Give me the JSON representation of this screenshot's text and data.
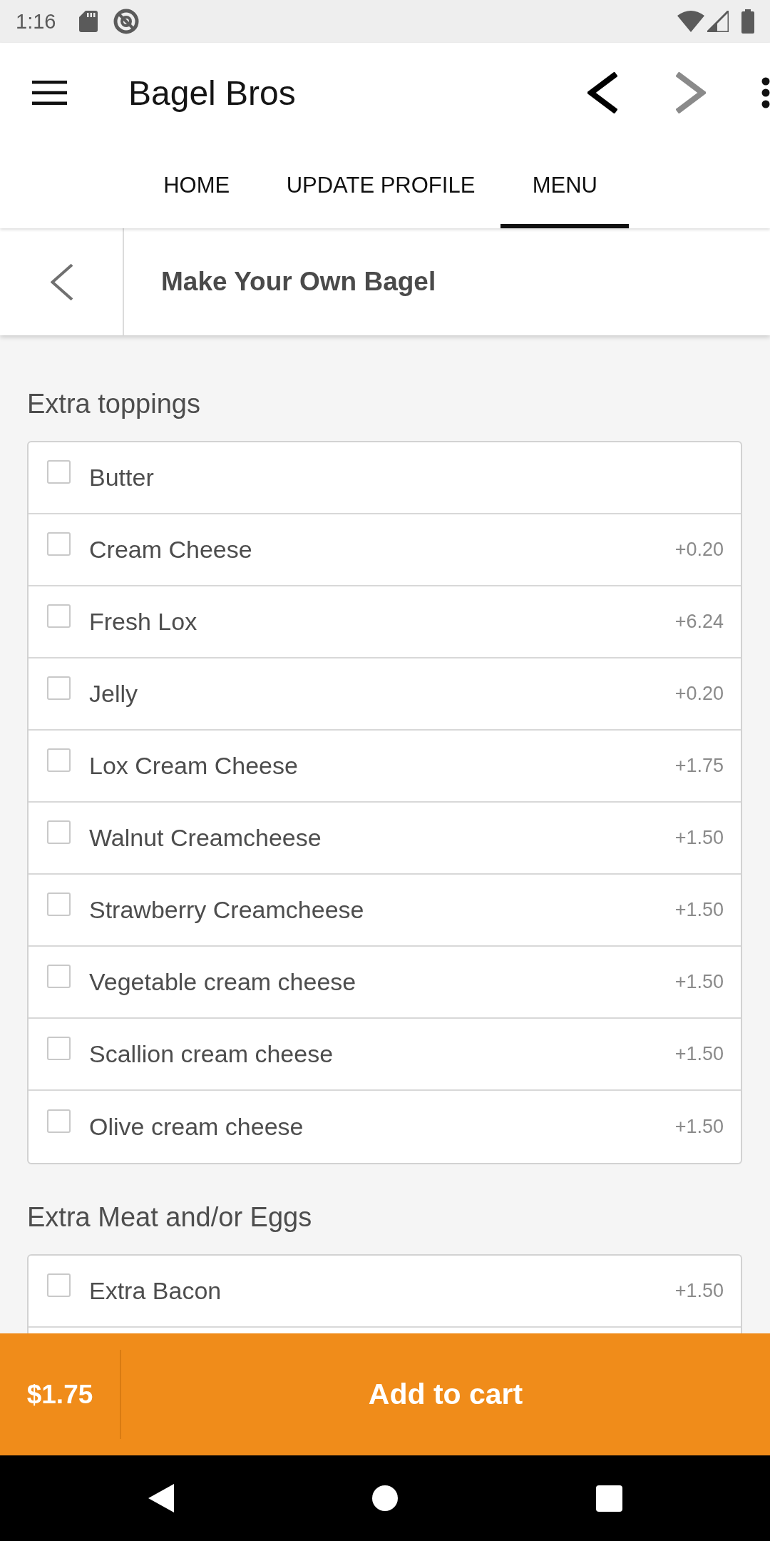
{
  "status_bar": {
    "time": "1:16"
  },
  "toolbar": {
    "title": "Bagel Bros",
    "nav_buttons": [
      {
        "kind": "back",
        "disabled": false
      },
      {
        "kind": "forward",
        "disabled": true
      }
    ]
  },
  "tabs": [
    {
      "label": "HOME",
      "selected": false
    },
    {
      "label": "UPDATE PROFILE",
      "selected": false
    },
    {
      "label": "MENU",
      "selected": true
    }
  ],
  "header": {
    "title": "Make Your Own Bagel"
  },
  "sections": [
    {
      "title": "Extra toppings",
      "options": [
        {
          "name": "Butter",
          "checked": false
        },
        {
          "name": "Cream Cheese",
          "price": "+0.20",
          "checked": false
        },
        {
          "name": "Fresh Lox",
          "price": "+6.24",
          "checked": false
        },
        {
          "name": "Jelly",
          "price": "+0.20",
          "checked": false
        },
        {
          "name": "Lox Cream Cheese",
          "price": "+1.75",
          "checked": false
        },
        {
          "name": "Walnut Creamcheese",
          "price": "+1.50",
          "checked": false
        },
        {
          "name": "Strawberry Creamcheese",
          "price": "+1.50",
          "checked": false
        },
        {
          "name": "Vegetable cream cheese",
          "price": "+1.50",
          "checked": false
        },
        {
          "name": "Scallion cream cheese",
          "price": "+1.50",
          "checked": false
        },
        {
          "name": "Olive cream cheese",
          "price": "+1.50",
          "checked": false
        }
      ]
    },
    {
      "title": "Extra Meat and/or Eggs",
      "options": [
        {
          "name": "Extra Bacon",
          "price": "+1.50",
          "checked": false
        }
      ]
    }
  ],
  "cart_bar": {
    "total": "$1.75",
    "button": "Add to cart"
  }
}
